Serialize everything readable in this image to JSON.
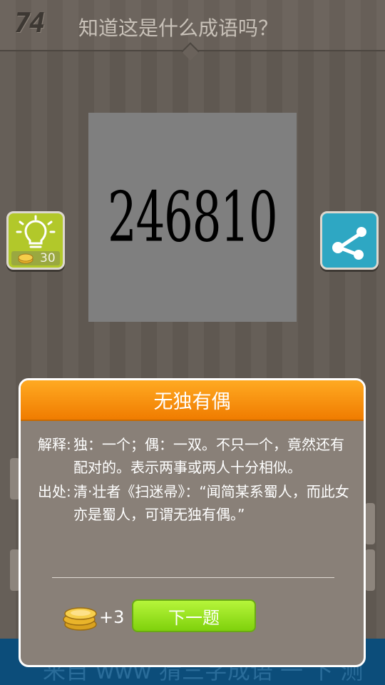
{
  "header": {
    "level": "74",
    "question": "知道这是什么成语吗？"
  },
  "puzzle": {
    "text": "246810"
  },
  "hint": {
    "cost": "30",
    "icon": "lightbulb-icon"
  },
  "share": {
    "icon": "share-icon"
  },
  "bottom_strip": {
    "text": "来自 www 猜三字成语 一 下 测"
  },
  "dialog": {
    "title": "无独有偶",
    "definition_label": "解释:",
    "definition_text": "独：一个；偶：一双。不只一个，竟然还有配对的。表示两事或两人十分相似。",
    "source_label": "出处:",
    "source_text": "清·壮者《扫迷帚》：“闻简某系蜀人，而此女亦是蜀人，可谓无独有偶。”",
    "reward": "+3",
    "next_label": "下一题"
  },
  "colors": {
    "header_orange": "#f28a00",
    "next_green": "#8fdc14",
    "hint_green": "#b2c82a",
    "share_blue": "#2ea7c3"
  }
}
